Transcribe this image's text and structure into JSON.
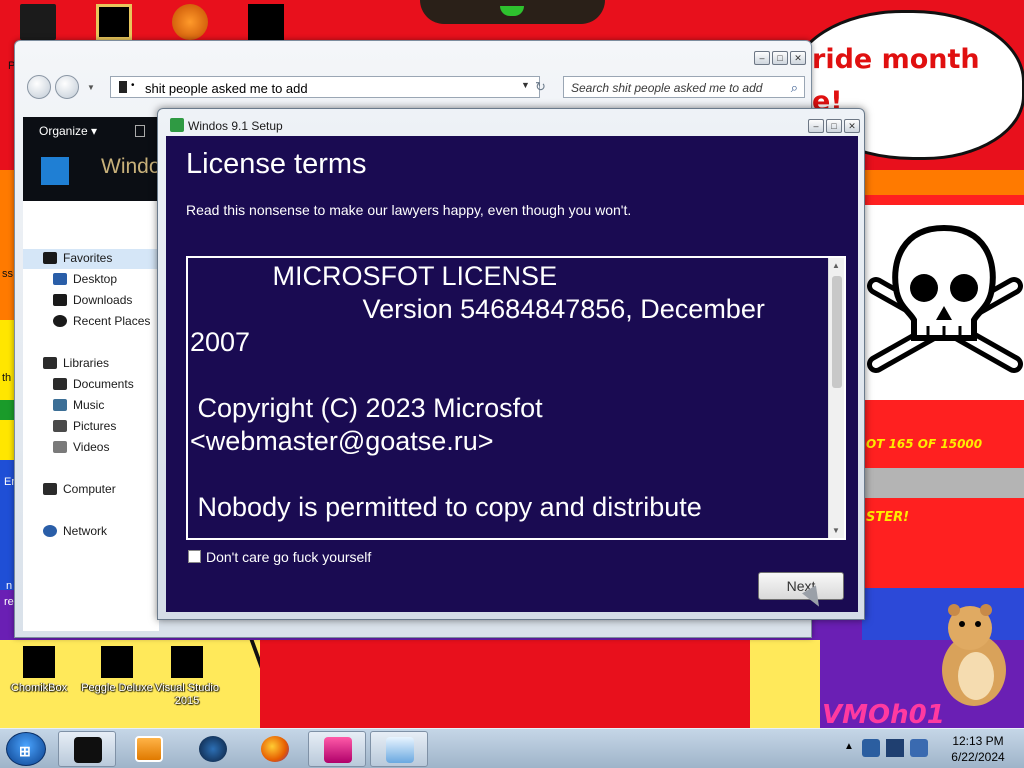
{
  "desktop": {
    "speech_bubble_line1": "ride month",
    "speech_bubble_line2": "e!",
    "poster_text1": "OT 165 OF 15000",
    "poster_text2": "STER!",
    "watermark": "VMOh01",
    "edge_labels": [
      "P",
      "ss",
      "th",
      "En",
      "n",
      "re"
    ],
    "icons": [
      {
        "label": "ChomikBox"
      },
      {
        "label": "Peggle Deluxe"
      },
      {
        "label": "Visual Studio 2015"
      }
    ],
    "colors": {
      "red": "#e8101c",
      "orange": "#ff7a00",
      "yellow": "#ffe600",
      "blue": "#1f4fd6",
      "purple": "#6a1fb4"
    }
  },
  "explorer": {
    "address": "shit people asked me to add",
    "search_placeholder": "Search shit people asked me to add",
    "organize_label": "Organize ▾",
    "banner_text": "Windo",
    "nav": {
      "favorites_header": "Favorites",
      "favorites": [
        "Desktop",
        "Downloads",
        "Recent Places"
      ],
      "libraries_header": "Libraries",
      "libraries": [
        "Documents",
        "Music",
        "Pictures",
        "Videos"
      ],
      "computer": "Computer",
      "network": "Network"
    },
    "window_buttons": {
      "min": "–",
      "max": "□",
      "close": "✕"
    }
  },
  "setup": {
    "window_title": "Windos 9.1 Setup",
    "heading": "License terms",
    "subtitle": "Read this nonsense to make our lawyers happy, even though you won't.",
    "license_text": "           MICROSFOT LICENSE\n                       Version 54684847856, December 2007\n\n Copyright (C) 2023 Microsfot <webmaster@goatse.ru>\n\n Nobody is permitted to copy and distribute",
    "checkbox_label": "Don't care go fuck yourself",
    "checkbox_checked": false,
    "next_label": "Next",
    "background_color": "#1a0b52"
  },
  "taskbar": {
    "time": "12:13 PM",
    "date": "6/22/2024",
    "pinned": [
      "dark-box",
      "media-player",
      "globe",
      "firefox",
      "pink-app",
      "setup"
    ]
  }
}
